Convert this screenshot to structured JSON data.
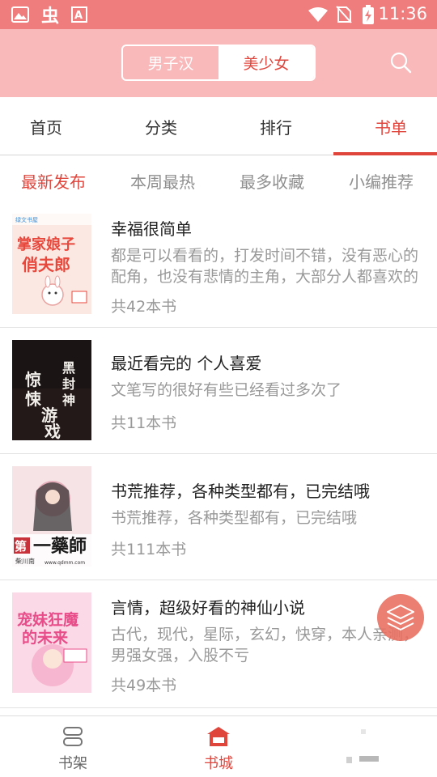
{
  "status_bar": {
    "time": "11:36",
    "icons": [
      "image-icon",
      "bug-icon",
      "a-badge-icon",
      "wifi-icon",
      "no-sim-icon",
      "battery-charging-icon"
    ]
  },
  "header": {
    "toggle": {
      "options": [
        "男子汉",
        "美少女"
      ],
      "selected": "美少女"
    },
    "search_icon": "search-icon"
  },
  "main_tabs": {
    "items": [
      "首页",
      "分类",
      "排行",
      "书单"
    ],
    "active": "书单"
  },
  "sub_tabs": {
    "items": [
      "最新发布",
      "本周最热",
      "最多收藏",
      "小编推荐"
    ],
    "active": "最新发布"
  },
  "booklists": [
    {
      "title": "幸福很简单",
      "description": "都是可以看看的，打发时间不错，没有恶心的配角，也没有悲情的主角，大部分人都喜欢的",
      "count": "共42本书",
      "cover": {
        "title": "掌家娘子俏夫郎",
        "tag": "绿文书屋",
        "colors": [
          "#fbe8e2",
          "#e8473c"
        ]
      }
    },
    {
      "title": "最近看完的 个人喜爱",
      "description": "文笔写的很好有些已经看过多次了",
      "count": "共11本书",
      "cover": {
        "title": "惊悚游戏",
        "subtitle": "我在黑封神",
        "colors": [
          "#1a1414",
          "#f2efea"
        ]
      }
    },
    {
      "title": "书荒推荐，各种类型都有，已完结哦",
      "description": "书荒推荐，各种类型都有，已完结哦",
      "count": "共111本书",
      "cover": {
        "title": "第一药师",
        "author": "柴川南",
        "site": "www.qdmm.com",
        "colors": [
          "#f5e3e6",
          "#c8323a"
        ]
      }
    },
    {
      "title": "言情，超级好看的神仙小说",
      "description": "古代，现代，星际，玄幻，快穿，本人亲测，男强女强，入股不亏",
      "count": "共49本书",
      "cover": {
        "title": "宠妹狂魔的未来",
        "colors": [
          "#fbd9e6",
          "#e84d8a"
        ]
      }
    }
  ],
  "fab": {
    "icon": "layers-icon"
  },
  "bottom_nav": {
    "items": [
      {
        "label": "书架",
        "icon": "bookshelf-icon"
      },
      {
        "label": "书城",
        "icon": "bookstore-icon"
      },
      {
        "label": "",
        "icon": "profile-icon"
      }
    ],
    "active": "书城"
  },
  "colors": {
    "accent": "#e0453c",
    "header_bg": "#f9b8ba",
    "status_bg": "#f07d7d",
    "muted_text": "#999999"
  }
}
